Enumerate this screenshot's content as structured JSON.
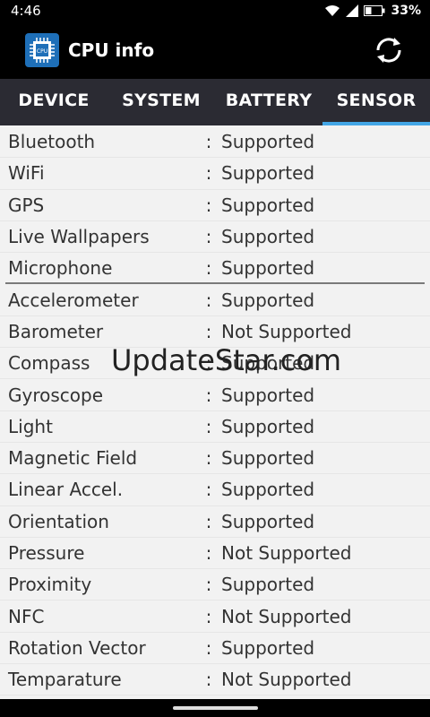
{
  "status": {
    "time": "4:46",
    "battery": "33%"
  },
  "app": {
    "title": "CPU info",
    "icon_text": "CPU"
  },
  "tabs": [
    {
      "label": "DEVICE"
    },
    {
      "label": "SYSTEM"
    },
    {
      "label": "BATTERY"
    },
    {
      "label": "SENSOR"
    }
  ],
  "rows": [
    {
      "label": "Bluetooth",
      "colon": ":",
      "value": "Supported"
    },
    {
      "label": "WiFi",
      "colon": ":",
      "value": "Supported"
    },
    {
      "label": "GPS",
      "colon": ":",
      "value": "Supported"
    },
    {
      "label": "Live Wallpapers",
      "colon": ":",
      "value": "Supported"
    },
    {
      "label": "Microphone",
      "colon": ":",
      "value": "Supported"
    },
    {
      "label": "Accelerometer",
      "colon": ":",
      "value": "Supported"
    },
    {
      "label": "Barometer",
      "colon": ":",
      "value": "Not Supported"
    },
    {
      "label": "Compass",
      "colon": ":",
      "value": "Supported"
    },
    {
      "label": "Gyroscope",
      "colon": ":",
      "value": "Supported"
    },
    {
      "label": "Light",
      "colon": ":",
      "value": "Supported"
    },
    {
      "label": "Magnetic Field",
      "colon": ":",
      "value": "Supported"
    },
    {
      "label": "Linear Accel.",
      "colon": ":",
      "value": "Supported"
    },
    {
      "label": "Orientation",
      "colon": ":",
      "value": "Supported"
    },
    {
      "label": "Pressure",
      "colon": ":",
      "value": "Not Supported"
    },
    {
      "label": "Proximity",
      "colon": ":",
      "value": "Supported"
    },
    {
      "label": "NFC",
      "colon": ":",
      "value": "Not Supported"
    },
    {
      "label": "Rotation Vector",
      "colon": ":",
      "value": "Supported"
    },
    {
      "label": "Temparature",
      "colon": ":",
      "value": "Not Supported"
    }
  ],
  "watermark": "UpdateStar.com"
}
